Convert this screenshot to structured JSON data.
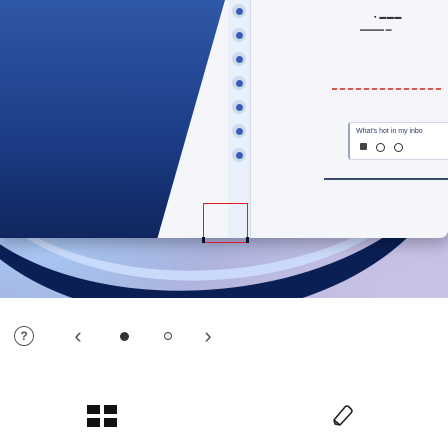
{
  "preview": {
    "title_text": "▪ ▬▬▬",
    "subtitle_text": "▬▬▬▬ ▬",
    "message_text": "What's hot in my inbo"
  },
  "pager": {
    "help_icon": "question-circle-icon",
    "prev_icon": "‹",
    "next_icon": "›",
    "current_page": 1,
    "total_pages": 2
  },
  "toolbar": {
    "grid_icon": "grid-icon",
    "pen_icon": "pen-icon"
  },
  "colors": {
    "crop_border": "#e11b22",
    "panel_blue": "#1b3c85"
  }
}
